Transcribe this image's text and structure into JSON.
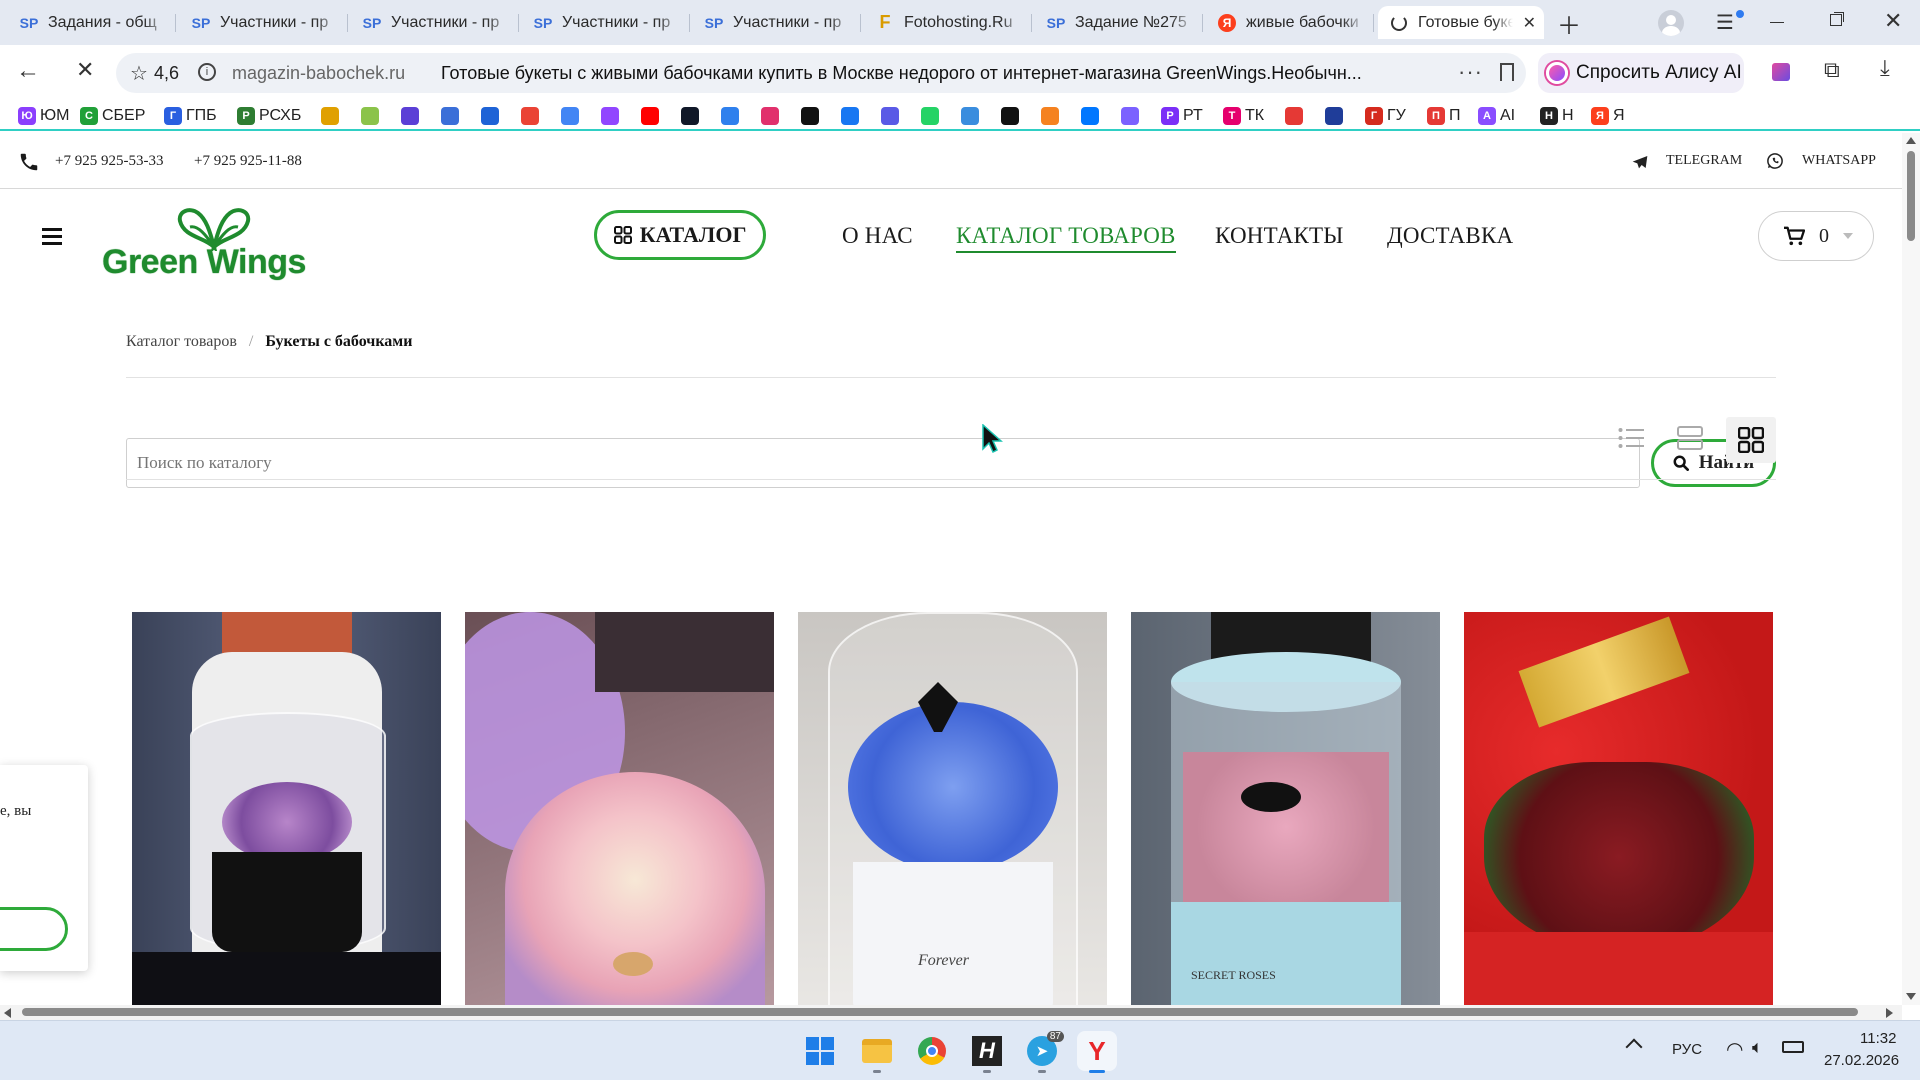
{
  "tabs": [
    {
      "label": "Задания - общ",
      "icon": "sp-icon"
    },
    {
      "label": "Участники - пр",
      "icon": "sp-icon"
    },
    {
      "label": "Участники - пр",
      "icon": "sp-icon"
    },
    {
      "label": "Участники - пр",
      "icon": "sp-icon"
    },
    {
      "label": "Участники - пр",
      "icon": "sp-icon"
    },
    {
      "label": "Fotohosting.Ru",
      "icon": "fotohosting-icon"
    },
    {
      "label": "Задание №275",
      "icon": "sp-icon"
    },
    {
      "label": "живые бабочки",
      "icon": "yandex-icon"
    },
    {
      "label": "Готовые букет",
      "icon": "loading-spinner-icon",
      "active": true
    }
  ],
  "toolbar": {
    "rating": "4,6",
    "domain": "magazin-babochek.ru",
    "page_title": "Готовые букеты с живыми бабочками купить в Москве недорого от интернет-магазина GreenWings.Необычн...",
    "alice_label": "Спросить Алису AI"
  },
  "bookmarks": [
    {
      "label": "ЮМ",
      "icon": "yumoney-icon",
      "color": "#8b3ffd"
    },
    {
      "label": "СБЕР",
      "icon": "sber-icon",
      "color": "#21a038"
    },
    {
      "label": "ГПБ",
      "icon": "gpb-icon",
      "color": "#2a5fe0"
    },
    {
      "label": "РСХБ",
      "icon": "rshb-icon",
      "color": "#2e7d32"
    },
    {
      "label": "",
      "icon": "fotohosting-icon",
      "color": "#e0a000"
    },
    {
      "label": "",
      "icon": "sf-icon",
      "color": "#8bc34a"
    },
    {
      "label": "",
      "icon": "shield-icon",
      "color": "#5b3fd6"
    },
    {
      "label": "",
      "icon": "sp-icon",
      "color": "#3b6fd8"
    },
    {
      "label": "",
      "icon": "mail-icon",
      "color": "#1e63d6"
    },
    {
      "label": "",
      "icon": "gmail-icon",
      "color": "#ea4335"
    },
    {
      "label": "",
      "icon": "google-icon",
      "color": "#4285f4"
    },
    {
      "label": "",
      "icon": "twitch-icon",
      "color": "#9146ff"
    },
    {
      "label": "",
      "icon": "youtube-icon",
      "color": "#ff0000"
    },
    {
      "label": "",
      "icon": "rutube-icon",
      "color": "#101828"
    },
    {
      "label": "",
      "icon": "pictures-icon",
      "color": "#2f80ed"
    },
    {
      "label": "",
      "icon": "instagram-icon",
      "color": "#e1306c"
    },
    {
      "label": "",
      "icon": "tiktok-icon",
      "color": "#111111"
    },
    {
      "label": "",
      "icon": "facebook-icon",
      "color": "#1877f2"
    },
    {
      "label": "",
      "icon": "camera-icon",
      "color": "#5a5ae6"
    },
    {
      "label": "",
      "icon": "whatsapp-icon",
      "color": "#25d366"
    },
    {
      "label": "",
      "icon": "tau-icon",
      "color": "#3a8dde"
    },
    {
      "label": "",
      "icon": "plus-icon",
      "color": "#111111"
    },
    {
      "label": "",
      "icon": "ok-icon",
      "color": "#f58220"
    },
    {
      "label": "",
      "icon": "vk-icon",
      "color": "#0077ff"
    },
    {
      "label": "",
      "icon": "apps-icon",
      "color": "#7b61ff"
    },
    {
      "label": "РТ",
      "icon": "rt-icon",
      "color": "#7b2ff7"
    },
    {
      "label": "ТК",
      "icon": "play-icon",
      "color": "#e5006d"
    },
    {
      "label": "",
      "icon": "link-icon",
      "color": "#e53935"
    },
    {
      "label": "",
      "icon": "emblem-icon",
      "color": "#1f3d99"
    },
    {
      "label": "ГУ",
      "icon": "flag-icon",
      "color": "#d52b1e"
    },
    {
      "label": "П",
      "icon": "umbrella-icon",
      "color": "#e53935"
    },
    {
      "label": "AI",
      "icon": "alice-icon",
      "color": "#8a4dff"
    },
    {
      "label": "Н",
      "icon": "plus-dark-icon",
      "color": "#222222"
    },
    {
      "label": "Я",
      "icon": "yandex-icon",
      "color": "#fc3f1d"
    }
  ],
  "site": {
    "phones": [
      "+7 925 925-53-33",
      "+7 925 925-11-88"
    ],
    "socials": [
      {
        "label": "TELEGRAM",
        "icon": "telegram-icon"
      },
      {
        "label": "WHATSAPP",
        "icon": "whatsapp-icon"
      }
    ],
    "logo_text": "Green Wings",
    "catalog_button": "КАТАЛОГ",
    "nav": [
      "О НАС",
      "КАТАЛОГ ТОВАРОВ",
      "КОНТАКТЫ",
      "ДОСТАВКА"
    ],
    "cart_count": "0",
    "breadcrumb": {
      "parent": "Каталог товаров",
      "separator": "/",
      "current": "Букеты с бабочками"
    },
    "search": {
      "placeholder": "Поиск по каталогу",
      "button": "Найти"
    },
    "popup_fragment": "е, вы",
    "products": [
      {
        "name": "girl-white-box-bouquet"
      },
      {
        "name": "lilac-box-roses"
      },
      {
        "name": "blue-hydrangea-forever-box",
        "box_text": "Forever"
      },
      {
        "name": "pink-hydrangea-box",
        "box_text": "SECRET ROSES"
      },
      {
        "name": "red-heart-box-roses"
      }
    ]
  },
  "colors": {
    "brand_green": "#2eaa3a",
    "logo_green": "#1f8b2e",
    "accent_teal": "#2fcfc4"
  },
  "taskbar": {
    "apps": [
      "windows-start-icon",
      "file-explorer-icon",
      "chrome-icon",
      "h-app-icon",
      "telegram-icon",
      "yandex-browser-icon"
    ],
    "telegram_badge": "87",
    "lang": "РУС",
    "time": "11:32",
    "date": "27.02.2026"
  }
}
